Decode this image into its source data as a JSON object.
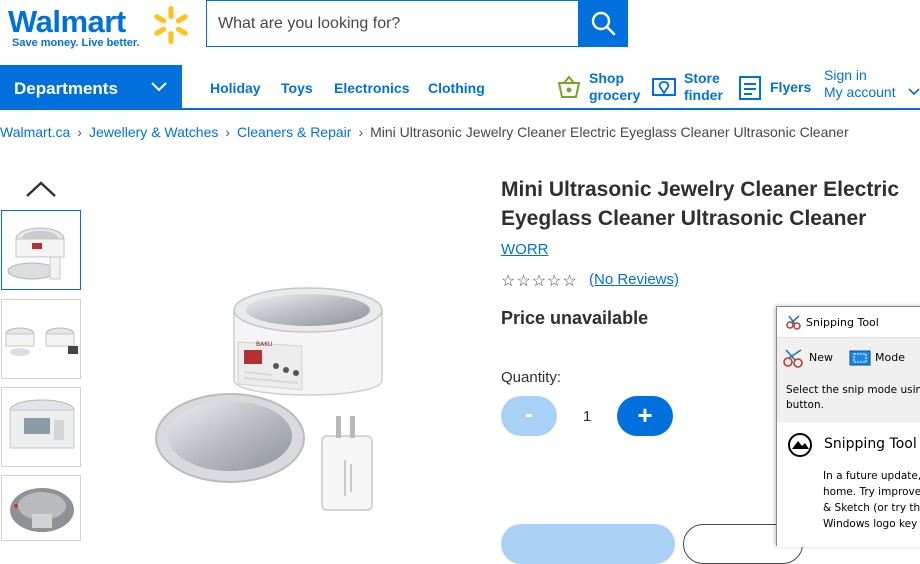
{
  "header": {
    "logo_text": "Walmart",
    "tagline": "Save money. Live better.",
    "search_placeholder": "What are you looking for?",
    "colors": {
      "brand_blue": "#0071dc",
      "spark_yellow": "#ffc220"
    }
  },
  "nav": {
    "departments": "Departments",
    "links": [
      "Holiday",
      "Toys",
      "Electronics",
      "Clothing"
    ],
    "shop_grocery": {
      "line1": "Shop",
      "line2": "grocery"
    },
    "store_finder": {
      "line1": "Store",
      "line2": "finder"
    },
    "flyers": "Flyers",
    "account": {
      "line1": "Sign in",
      "line2": "My account"
    }
  },
  "breadcrumb": {
    "items": [
      "Walmart.ca",
      "Jewellery & Watches",
      "Cleaners & Repair"
    ],
    "separator": "›",
    "current": "Mini Ultrasonic Jewelry Cleaner Electric Eyeglass Cleaner Ultrasonic Cleaner"
  },
  "product": {
    "title_line1": "Mini Ultrasonic Jewelry Cleaner Electric",
    "title_line2": "Eyeglass Cleaner Ultrasonic Cleaner",
    "brand": "WORR",
    "stars": "☆☆☆☆☆",
    "rating": 0,
    "reviews": "(No Reviews)",
    "price": "Price unavailable",
    "quantity_label": "Quantity:",
    "quantity": "1",
    "minus": "-",
    "plus": "+"
  },
  "snipping_tool": {
    "title": "Snipping Tool",
    "new": "New",
    "mode": "Mode",
    "hint_line1": "Select the snip mode usin",
    "hint_line2": "button.",
    "heading": "Snipping Tool",
    "body_lines": [
      "In a future update,",
      "home. Try improve",
      "& Sketch (or try th",
      "Windows logo key"
    ]
  }
}
